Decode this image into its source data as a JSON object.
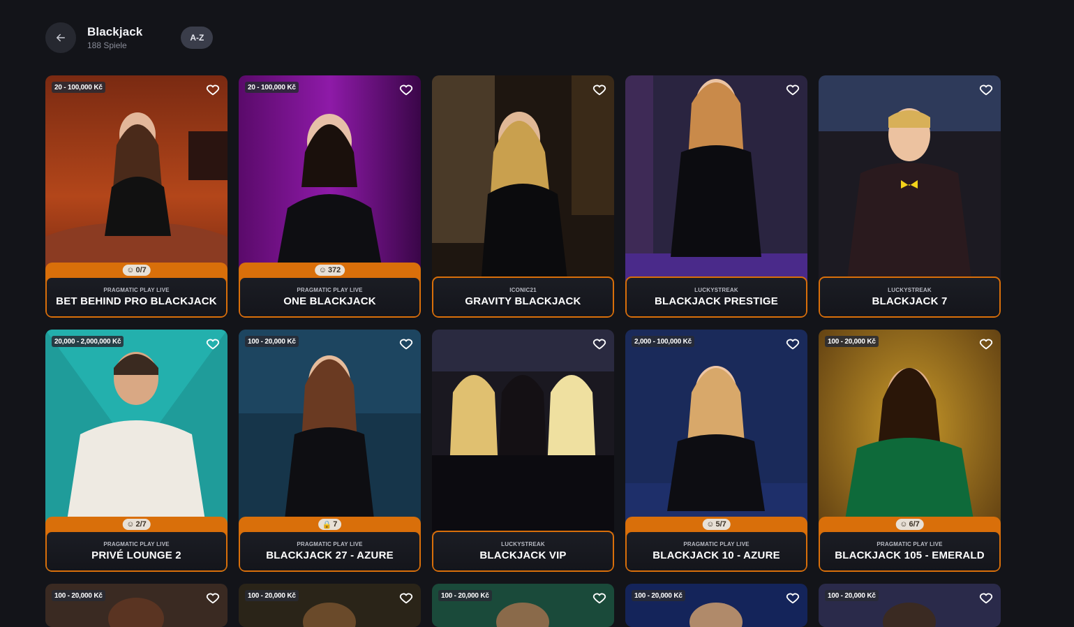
{
  "header": {
    "title": "Blackjack",
    "subtitle": "188 Spiele",
    "sort_label": "A-Z"
  },
  "colors": {
    "accent": "#d96f0a",
    "background": "#131419"
  },
  "icons": {
    "back": "arrow-left-icon",
    "favorite": "heart-icon",
    "seat": "seat-icon",
    "lock": "lock-icon"
  },
  "cards": [
    {
      "limit": "20 - 100,000 Kč",
      "seats": "0/7",
      "provider": "PRAGMATIC PLAY LIVE",
      "name": "BET BEHIND PRO BLACKJACK"
    },
    {
      "limit": "20 - 100,000 Kč",
      "seats": "372",
      "provider": "PRAGMATIC PLAY LIVE",
      "name": "ONE BLACKJACK"
    },
    {
      "limit": "",
      "seats": "",
      "provider": "ICONIC21",
      "name": "GRAVITY BLACKJACK"
    },
    {
      "limit": "",
      "seats": "",
      "provider": "LUCKYSTREAK",
      "name": "BLACKJACK PRESTIGE"
    },
    {
      "limit": "",
      "seats": "",
      "provider": "LUCKYSTREAK",
      "name": "BLACKJACK 7"
    },
    {
      "limit": "20,000 - 2,000,000 Kč",
      "seats": "2/7",
      "provider": "PRAGMATIC PLAY LIVE",
      "name": "PRIVÉ LOUNGE 2"
    },
    {
      "limit": "100 - 20,000 Kč",
      "seats": "7",
      "provider": "PRAGMATIC PLAY LIVE",
      "name": "BLACKJACK 27 - AZURE"
    },
    {
      "limit": "",
      "seats": "",
      "provider": "LUCKYSTREAK",
      "name": "BLACKJACK VIP"
    },
    {
      "limit": "2,000 - 100,000 Kč",
      "seats": "5/7",
      "provider": "PRAGMATIC PLAY LIVE",
      "name": "BLACKJACK 10 - AZURE"
    },
    {
      "limit": "100 - 20,000 Kč",
      "seats": "6/7",
      "provider": "PRAGMATIC PLAY LIVE",
      "name": "BLACKJACK 105 - EMERALD"
    },
    {
      "limit": "100 - 20,000 Kč"
    },
    {
      "limit": "100 - 20,000 Kč"
    },
    {
      "limit": "100 - 20,000 Kč"
    },
    {
      "limit": "100 - 20,000 Kč"
    },
    {
      "limit": "100 - 20,000 Kč"
    }
  ]
}
